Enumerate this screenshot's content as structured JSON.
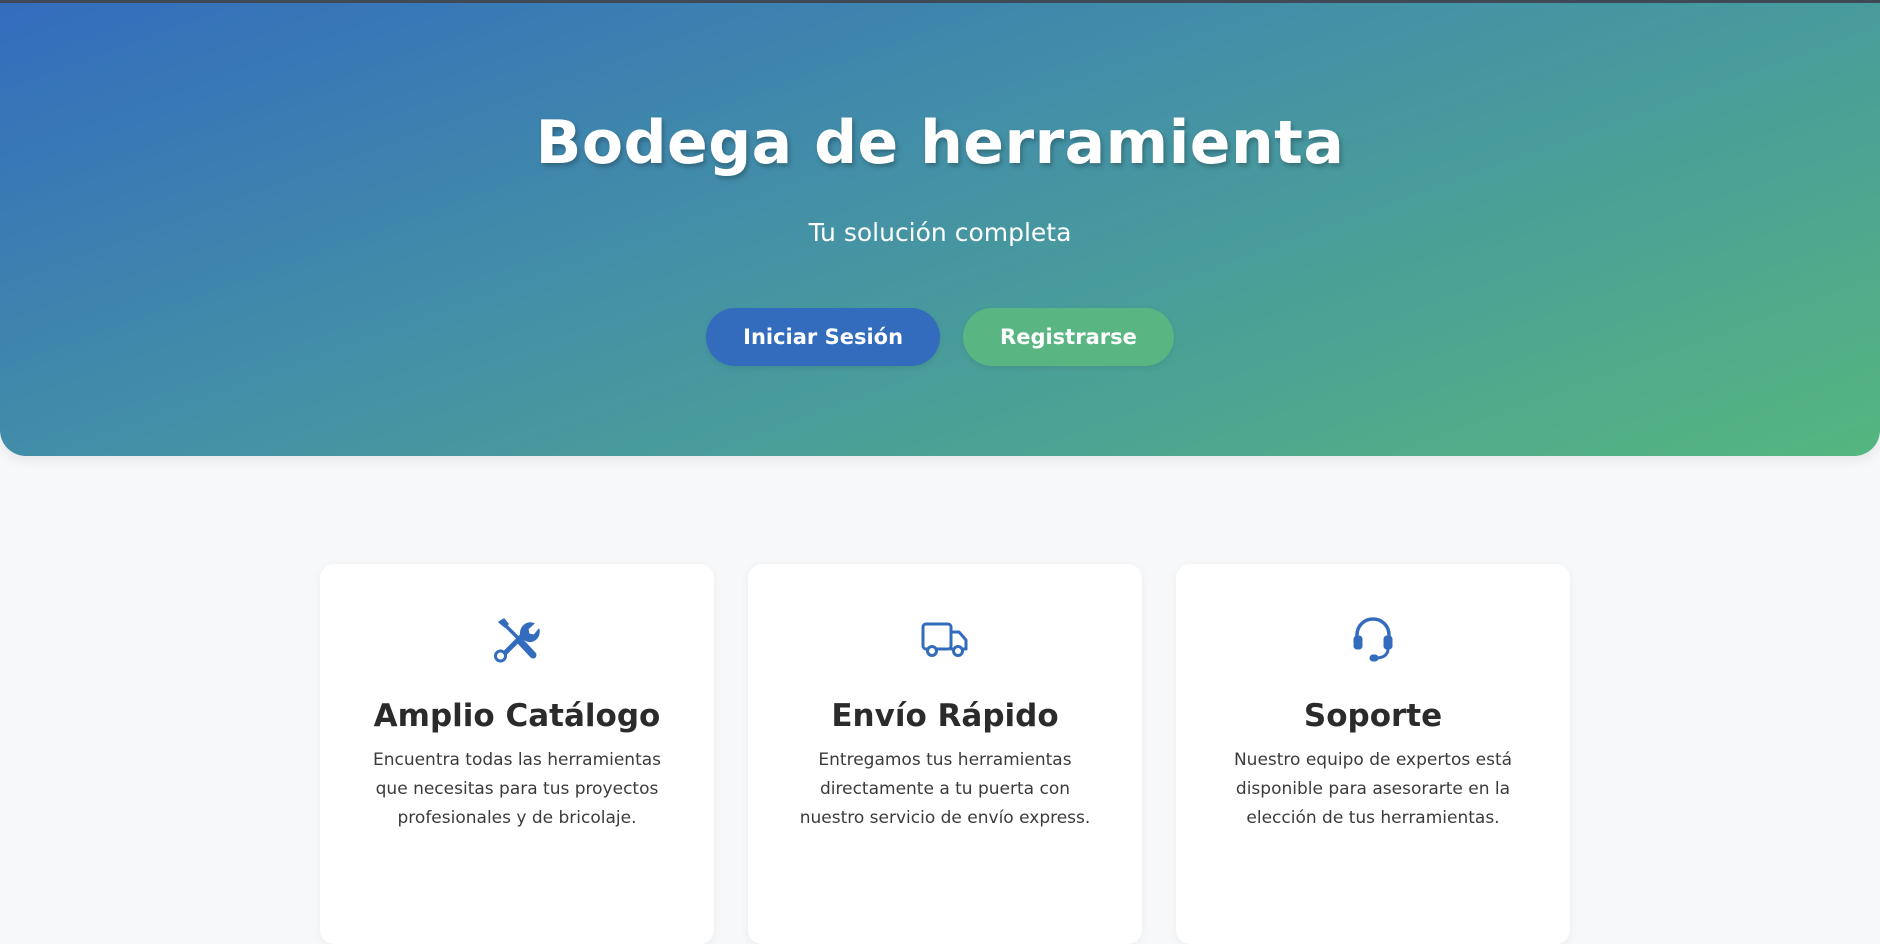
{
  "hero": {
    "title": "Bodega de herramienta",
    "subtitle": "Tu solución completa",
    "login_label": "Iniciar Sesión",
    "register_label": "Registrarse"
  },
  "features": [
    {
      "icon": "tools-icon",
      "title": "Amplio Catálogo",
      "text": "Encuentra todas las herramientas que necesitas para tus proyectos profesionales y de bricolaje."
    },
    {
      "icon": "truck-icon",
      "title": "Envío Rápido",
      "text": "Entregamos tus herramientas directamente a tu puerta con nuestro servicio de envío express."
    },
    {
      "icon": "headset-icon",
      "title": "Soporte",
      "text": "Nuestro equipo de expertos está disponible para asesorarte en la elección de tus herramientas."
    }
  ],
  "colors": {
    "primary": "#336cbd",
    "secondary": "#59b682",
    "background": "#f7f8fa"
  }
}
